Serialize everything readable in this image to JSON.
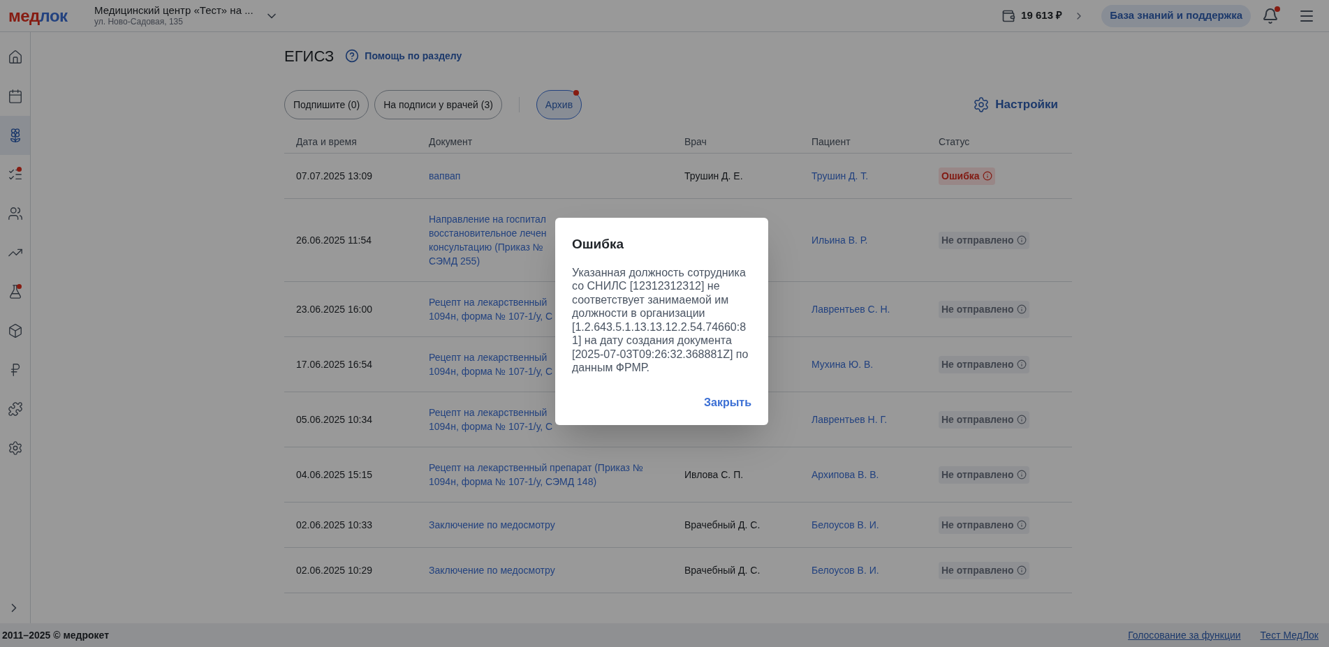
{
  "header": {
    "logo": [
      "мед",
      "лок"
    ],
    "clinic": "Медицинский центр «Тест» на ...",
    "address": "ул. Ново-Садовая, 135",
    "balance": "19 613 ₽",
    "support": "База знаний и поддержка",
    "notifications_unread": true
  },
  "sidebar": {
    "items": [
      {
        "selected": false,
        "badge": false
      },
      {
        "selected": false,
        "badge": false
      },
      {
        "selected": true,
        "badge": false
      },
      {
        "selected": false,
        "badge": true
      },
      {
        "selected": false,
        "badge": false
      },
      {
        "selected": false,
        "badge": false
      },
      {
        "selected": false,
        "badge": true
      },
      {
        "selected": false,
        "badge": false
      },
      {
        "selected": false,
        "badge": false
      },
      {
        "selected": false,
        "badge": false
      },
      {
        "selected": false,
        "badge": false
      }
    ]
  },
  "page": {
    "title": "ЕГИСЗ",
    "help": "Помощь по разделу",
    "settings": "Настройки"
  },
  "tabs": [
    {
      "label": "Подпишите (0)",
      "selected": false,
      "badge": false
    },
    {
      "label": "На подписи у врачей (3)",
      "selected": false,
      "badge": false
    },
    {
      "label": "Архив",
      "selected": true,
      "badge": true
    }
  ],
  "table": {
    "columns": [
      "Дата и время",
      "Документ",
      "Врач",
      "Пациент",
      "Статус"
    ],
    "rows": [
      {
        "date": "07.07.2025 13:09",
        "document": [
          "вапвап"
        ],
        "doctor": "Трушин Д. Е.",
        "patient": "Трушин Д. Т.",
        "status": {
          "kind": "error",
          "text": "Ошибка"
        }
      },
      {
        "date": "26.06.2025 11:54",
        "document": [
          "Направление на госпитал",
          "восстановительное лечен",
          "консультацию (Приказ №",
          "СЭМД 255)"
        ],
        "patient": "Ильина В. Р.",
        "status": {
          "kind": "not_sent",
          "text": "Не отправлено"
        }
      },
      {
        "date": "23.06.2025 16:00",
        "document": [
          "Рецепт на лекарственный",
          "1094н, форма № 107-1/у, С"
        ],
        "patient": "Лаврентьев С. Н.",
        "status": {
          "kind": "not_sent",
          "text": "Не отправлено"
        }
      },
      {
        "date": "17.06.2025 16:54",
        "document": [
          "Рецепт на лекарственный",
          "1094н, форма № 107-1/у, С"
        ],
        "patient": "Мухина Ю. В.",
        "status": {
          "kind": "not_sent",
          "text": "Не отправлено"
        }
      },
      {
        "date": "05.06.2025 10:34",
        "document": [
          "Рецепт на лекарственный",
          "1094н, форма № 107-1/у, С"
        ],
        "patient": "Лаврентьев Н. Г.",
        "status": {
          "kind": "not_sent",
          "text": "Не отправлено"
        }
      },
      {
        "date": "04.06.2025 15:15",
        "document": [
          "Рецепт на лекарственный препарат (Приказ №",
          "1094н, форма № 107-1/у, СЭМД 148)"
        ],
        "doctor": "Ивлова С. П.",
        "patient": "Архипова В. В.",
        "status": {
          "kind": "not_sent",
          "text": "Не отправлено"
        }
      },
      {
        "date": "02.06.2025 10:33",
        "document": [
          "Заключение по медосмотру"
        ],
        "doctor": "Врачебный Д. С.",
        "patient": "Белоусов В. И.",
        "status": {
          "kind": "not_sent",
          "text": "Не отправлено"
        }
      },
      {
        "date": "02.06.2025 10:29",
        "document": [
          "Заключение по медосмотру"
        ],
        "doctor": "Врачебный Д. С.",
        "patient": "Белоусов В. И.",
        "status": {
          "kind": "not_sent",
          "text": "Не отправлено"
        }
      }
    ]
  },
  "footer": {
    "copyright": "2011–2025 © медрокет",
    "links": [
      "Голосование за функции",
      "Тест МедЛок"
    ]
  },
  "dialog": {
    "title": "Ошибка",
    "message": "Указанная должность сотрудника со СНИЛС [12312312312] не соответствует занимаемой им должности в организации [1.2.643.5.1.13.13.12.2.54.74660:81] на дату создания документа [2025-07-03T09:26:32.368881Z] по данным ФРМР.",
    "close": "Закрыть"
  }
}
